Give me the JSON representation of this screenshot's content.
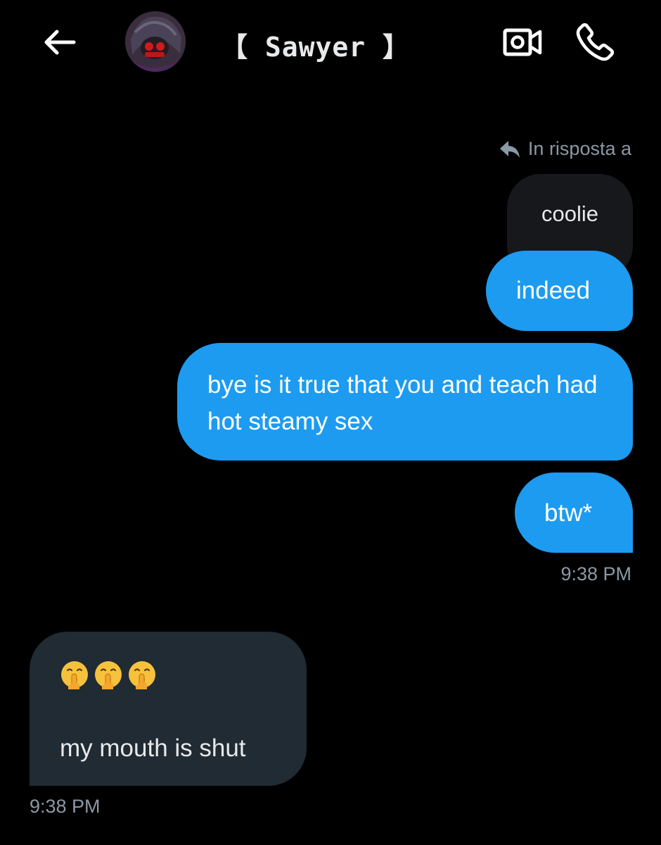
{
  "header": {
    "contact_name": "【 Sawyer 】",
    "back_icon": "arrow-left-icon",
    "video_icon": "video-camera-icon",
    "call_icon": "phone-icon"
  },
  "conversation": {
    "reply_indicator": "In risposta a",
    "quoted_message": "coolie",
    "sent_messages": [
      {
        "text": "indeed"
      },
      {
        "text": "bye is it true that you and teach had hot steamy sex"
      },
      {
        "text": "btw*"
      }
    ],
    "sent_timestamp": "9:38 PM",
    "received_message": {
      "emoji": "🤫🤫🤫",
      "emoji_icon": "shushing-face-icon",
      "text": "my mouth is shut"
    },
    "received_timestamp": "9:38 PM"
  },
  "colors": {
    "background": "#000000",
    "sent_bubble": "#1d9bf0",
    "received_bubble": "#202b33",
    "quoted_bubble": "#16181c",
    "muted_text": "#8b98a5"
  }
}
